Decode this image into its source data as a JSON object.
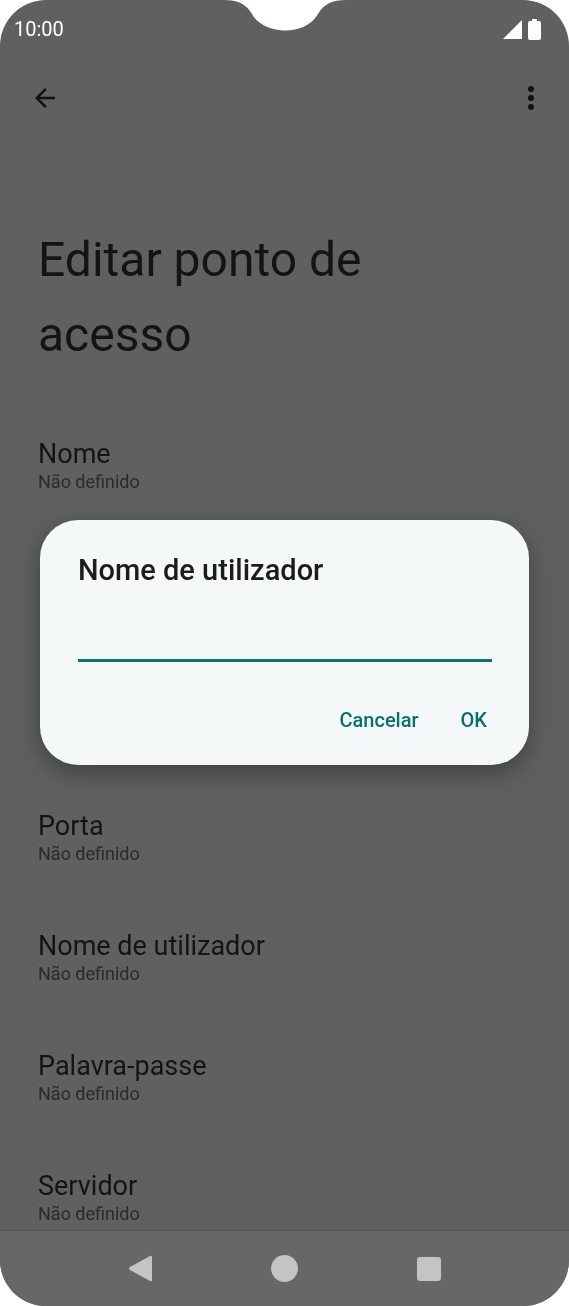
{
  "status_bar": {
    "time": "10:00"
  },
  "page": {
    "title": "Editar ponto de acesso"
  },
  "settings_top": [
    {
      "label": "Nome",
      "value": "Não definido"
    }
  ],
  "settings_bottom": [
    {
      "label": "Porta",
      "value": "Não definido"
    },
    {
      "label": "Nome de utilizador",
      "value": "Não definido"
    },
    {
      "label": "Palavra-passe",
      "value": "Não definido"
    },
    {
      "label": "Servidor",
      "value": "Não definido"
    }
  ],
  "dialog": {
    "title": "Nome de utilizador",
    "buttons": [
      "Cancelar",
      "OK"
    ]
  }
}
